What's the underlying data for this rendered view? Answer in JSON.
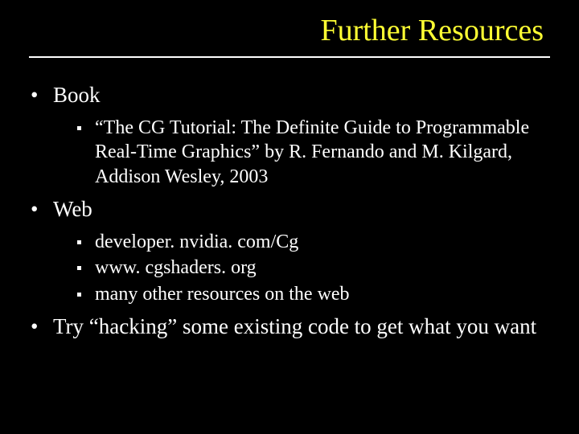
{
  "title": "Further Resources",
  "bullets": {
    "book": {
      "label": "Book",
      "items": [
        "“The CG Tutorial: The Definite Guide to Programmable Real-Time Graphics” by R. Fernando and M. Kilgard, Addison Wesley, 2003"
      ]
    },
    "web": {
      "label": "Web",
      "items": [
        "developer. nvidia. com/Cg",
        "www. cgshaders. org",
        "many other resources on the web"
      ]
    },
    "hacking": {
      "label": "Try “hacking” some existing code to get what you want"
    }
  }
}
